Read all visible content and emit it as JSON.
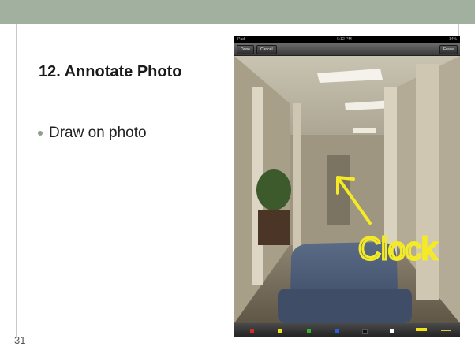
{
  "slide": {
    "title": "12. Annotate Photo",
    "bullet": "Draw on photo",
    "number": "31"
  },
  "ipad": {
    "status": {
      "device": "iPad",
      "time": "6:12 PM",
      "battery": "14%"
    },
    "toolbar": {
      "done_label": "Done",
      "cancel_label": "Cancel",
      "erase_label": "Erase"
    },
    "annotation_text": "Clock",
    "palette": [
      "#d62a2a",
      "#f2e11c",
      "#36b336",
      "#2f5fd6",
      "#111111",
      "#ffffff",
      "#f2e11c"
    ]
  },
  "colors": {
    "header_bar": "#a2b0a0",
    "annotation": "#f4ea25"
  }
}
